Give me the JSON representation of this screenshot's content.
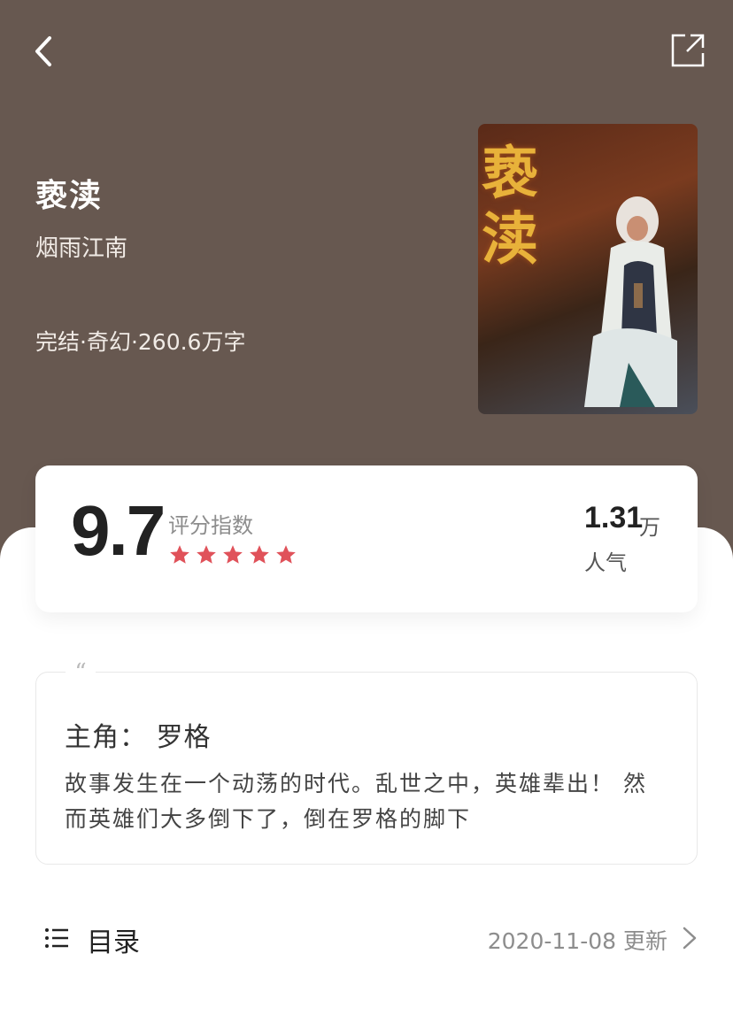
{
  "book": {
    "title": "亵渎",
    "author": "烟雨江南",
    "meta": "完结·奇幻·260.6万字",
    "cover_title": "亵渎"
  },
  "rating": {
    "score": "9.7",
    "label": "评分指数",
    "stars": 5,
    "star_color": "#e0525a",
    "popularity_value": "1.31",
    "popularity_unit": "万",
    "popularity_label": "人气"
  },
  "intro": {
    "quote_mark": "“",
    "protagonist": "主角： 罗格",
    "text": "故事发生在一个动荡的时代。乱世之中，英雄辈出！ 然而英雄们大多倒下了，倒在罗格的脚下"
  },
  "toc": {
    "label": "目录",
    "update": "2020-11-08 更新"
  },
  "icons": {
    "back": "chevron-left-icon",
    "share": "share-icon",
    "list": "list-icon",
    "chevron": "chevron-right-icon"
  },
  "colors": {
    "header_bg": "#675850",
    "accent_star": "#e0525a"
  }
}
